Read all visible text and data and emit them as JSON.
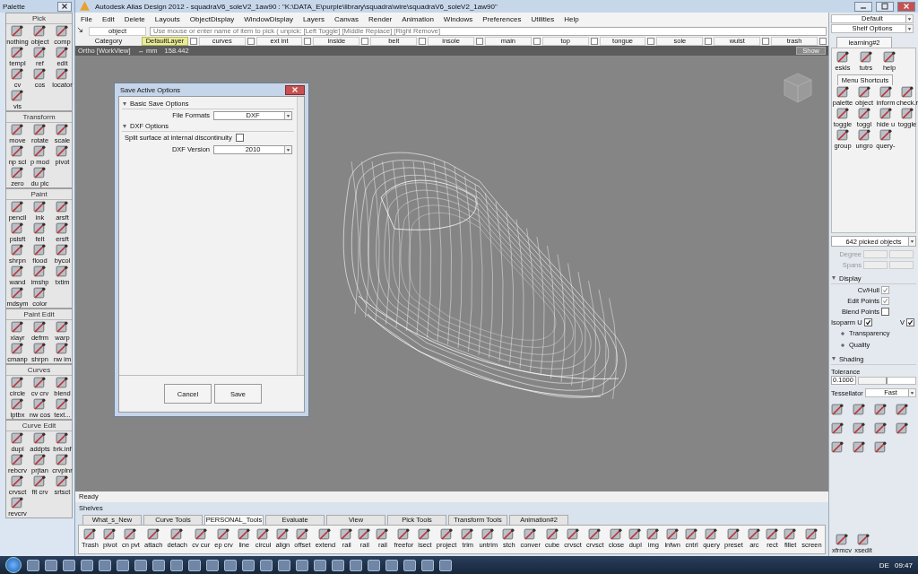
{
  "window": {
    "title": "Autodesk Alias Design 2012 - squadraV6_soleV2_1aw90 : \"K:\\DATA_E\\purple\\library\\squadra\\wire\\squadraV6_soleV2_1aw90\""
  },
  "palette": {
    "title": "Palette",
    "sections": [
      {
        "title": "Pick",
        "items": [
          "nothing",
          "object",
          "comp",
          "templ",
          "ref",
          "edit",
          "cv",
          "cos",
          "locator",
          "vis"
        ]
      },
      {
        "title": "Transform",
        "items": [
          "move",
          "rotate",
          "scale",
          "np scl",
          "p mod",
          "pivot",
          "zero",
          "du plc"
        ]
      },
      {
        "title": "Paint",
        "items": [
          "pencil",
          "ink",
          "arsft",
          "pslsft",
          "felt",
          "ersft",
          "shrpn",
          "flood",
          "bycol",
          "wand",
          "imshp",
          "txtim",
          "mdsym",
          "color"
        ]
      },
      {
        "title": "Paint Edit",
        "items": [
          "xlayr",
          "defrm",
          "warp",
          "cmanp",
          "shrpn",
          "nw im"
        ]
      },
      {
        "title": "Curves",
        "items": [
          "circle",
          "cv crv",
          "blend",
          "lptbx",
          "nw cos",
          "text..."
        ]
      },
      {
        "title": "Curve Edit",
        "items": [
          "dupl",
          "addpts",
          "brk.inf",
          "rebcrv",
          "prjtan",
          "crvplnr",
          "crvsct",
          "fit crv",
          "srtsct",
          "revcrv"
        ]
      }
    ]
  },
  "menu": [
    "File",
    "Edit",
    "Delete",
    "Layouts",
    "ObjectDisplay",
    "WindowDisplay",
    "Layers",
    "Canvas",
    "Render",
    "Animation",
    "Windows",
    "Preferences",
    "Utilities",
    "Help"
  ],
  "pick_bar": {
    "mode": "object",
    "prompt": "Use mouse or enter name of item to pick ( unpick: [Left Toggle] [Middle Replace] [Right Remove]"
  },
  "layer_bar": {
    "category": "Category",
    "layers": [
      {
        "name": "DefaultLayer",
        "selected": true
      },
      {
        "name": "curves",
        "selected": false
      },
      {
        "name": "ext int",
        "selected": false
      },
      {
        "name": "inside",
        "selected": false
      },
      {
        "name": "belt",
        "selected": false
      },
      {
        "name": "insole",
        "selected": false
      },
      {
        "name": "main",
        "selected": false
      },
      {
        "name": "top",
        "selected": false
      },
      {
        "name": "tongue",
        "selected": false
      },
      {
        "name": "sole",
        "selected": false
      },
      {
        "name": "wulst",
        "selected": false
      },
      {
        "name": "trash",
        "selected": false
      }
    ]
  },
  "viewport": {
    "view": "Ortho [WorkView]",
    "units": "↔ mm",
    "value": "158.442",
    "show_button": "Show"
  },
  "dialog": {
    "title": "Save Active Options",
    "sections": [
      {
        "title": "Basic Save Options",
        "fields": [
          {
            "kind": "dropdown",
            "label": "File Formats",
            "value": "DXF"
          }
        ]
      },
      {
        "title": "DXF Options",
        "fields": [
          {
            "kind": "checkbox",
            "label": "Split surface at internal discontinuity",
            "checked": false
          },
          {
            "kind": "dropdown",
            "label": "DXF Version",
            "value": "2010"
          }
        ]
      }
    ],
    "buttons": [
      "Cancel",
      "Save"
    ]
  },
  "status": "Ready",
  "right_panel": {
    "preset": "Default",
    "shelf_options": "Shelf Options",
    "shelf_tab": "learning#2",
    "shelf_items": [
      "eskls",
      "tutrs",
      "help"
    ],
    "shortcuts_tab": "Menu Shortcuts",
    "shortcuts": [
      "palette",
      "object",
      "inform",
      "check.r",
      "toggle",
      "toggl",
      "hide u",
      "toggle",
      "group",
      "ungro",
      "query-"
    ],
    "picked": "642 picked objects",
    "degree": "Degree",
    "spans": "Spans",
    "display": {
      "title": "Display",
      "options": [
        {
          "label": "Cv/Hull",
          "checked": true,
          "disabled": true
        },
        {
          "label": "Edit Points",
          "checked": true,
          "disabled": true
        },
        {
          "label": "Blend Points",
          "checked": false,
          "disabled": false
        }
      ],
      "isoparm_label": "Isoparm U",
      "isoparm_u": true,
      "v_label": "V",
      "isoparm_v": true,
      "groups": [
        "Transparency",
        "Quality"
      ]
    },
    "shading": {
      "title": "Shading",
      "tolerance_label": "Tolerance",
      "tolerance": "0.1000",
      "level": 0.5,
      "tessellator_label": "Tessellator",
      "tessellator": "Fast"
    },
    "tools": [
      "xfrmcv",
      "xsedit"
    ]
  },
  "shelves": {
    "title": "Shelves",
    "tabs": [
      {
        "label": "What_s_New",
        "selected": false
      },
      {
        "label": "Curve Tools",
        "selected": false
      },
      {
        "label": "PERSONAL_Tools",
        "selected": true
      },
      {
        "label": "Evaluate",
        "selected": false
      },
      {
        "label": "View",
        "selected": false
      },
      {
        "label": "Pick Tools",
        "selected": false
      },
      {
        "label": "Transform Tools",
        "selected": false
      },
      {
        "label": "Animation#2",
        "selected": false
      }
    ],
    "items": [
      "Trash",
      "pivot",
      "cn pvt",
      "attach",
      "detach",
      "cv cur",
      "ep crv",
      "line",
      "circul",
      "align",
      "offset",
      "extend",
      "rail",
      "rail",
      "rail",
      "freefor",
      "isect",
      "project",
      "trim",
      "untrim",
      "stch",
      "conver",
      "cube",
      "crvsct",
      "crvsct",
      "close",
      "dupl",
      "img",
      "lnfwn",
      "cntrl",
      "query",
      "preset",
      "arc",
      "rect",
      "fillet",
      "screen"
    ]
  },
  "taskbar": {
    "language": "DE",
    "time": "09:47"
  }
}
